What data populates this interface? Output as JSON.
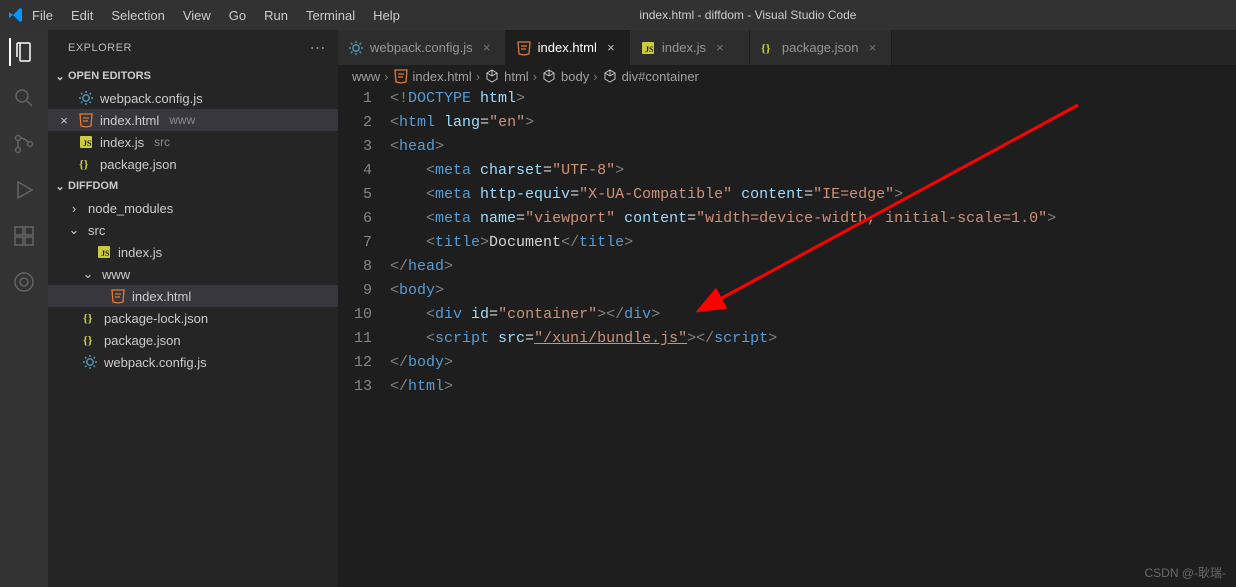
{
  "titlebar": {
    "title": "index.html - diffdom - Visual Studio Code",
    "menu": [
      "File",
      "Edit",
      "Selection",
      "View",
      "Go",
      "Run",
      "Terminal",
      "Help"
    ]
  },
  "sidebar": {
    "title": "EXPLORER",
    "sections": {
      "open_editors": {
        "label": "OPEN EDITORS",
        "items": [
          {
            "name": "webpack.config.js",
            "icon": "gear",
            "close": false
          },
          {
            "name": "index.html",
            "meta": "www",
            "icon": "html",
            "close": true,
            "active": true
          },
          {
            "name": "index.js",
            "meta": "src",
            "icon": "js",
            "close": false
          },
          {
            "name": "package.json",
            "icon": "json",
            "close": false
          }
        ]
      },
      "project": {
        "label": "DIFFDOM",
        "tree": [
          {
            "name": "node_modules",
            "type": "folder",
            "expanded": false,
            "indent": 0
          },
          {
            "name": "src",
            "type": "folder",
            "expanded": true,
            "indent": 0
          },
          {
            "name": "index.js",
            "type": "file",
            "icon": "js",
            "indent": 1
          },
          {
            "name": "www",
            "type": "folder",
            "expanded": true,
            "indent": 1
          },
          {
            "name": "index.html",
            "type": "file",
            "icon": "html",
            "indent": 2,
            "active": true
          },
          {
            "name": "package-lock.json",
            "type": "file",
            "icon": "json",
            "indent": 0
          },
          {
            "name": "package.json",
            "type": "file",
            "icon": "json",
            "indent": 0
          },
          {
            "name": "webpack.config.js",
            "type": "file",
            "icon": "gear",
            "indent": 0
          }
        ]
      }
    }
  },
  "tabs": [
    {
      "name": "webpack.config.js",
      "icon": "gear",
      "active": false
    },
    {
      "name": "index.html",
      "icon": "html",
      "active": true
    },
    {
      "name": "index.js",
      "icon": "js",
      "active": false
    },
    {
      "name": "package.json",
      "icon": "json",
      "active": false
    }
  ],
  "breadcrumb": [
    "www",
    "index.html",
    "html",
    "body",
    "div#container"
  ],
  "code": {
    "lines": [
      [
        {
          "t": "<!",
          "c": "bracket"
        },
        {
          "t": "DOCTYPE",
          "c": "doctype"
        },
        {
          "t": " html",
          "c": "attr"
        },
        {
          "t": ">",
          "c": "bracket"
        }
      ],
      [
        {
          "t": "<",
          "c": "bracket"
        },
        {
          "t": "html",
          "c": "tag"
        },
        {
          "t": " lang",
          "c": "attr"
        },
        {
          "t": "=",
          "c": "text"
        },
        {
          "t": "\"en\"",
          "c": "str"
        },
        {
          "t": ">",
          "c": "bracket"
        }
      ],
      [
        {
          "t": "<",
          "c": "bracket"
        },
        {
          "t": "head",
          "c": "tag"
        },
        {
          "t": ">",
          "c": "bracket"
        }
      ],
      [
        {
          "t": "    <",
          "c": "bracket"
        },
        {
          "t": "meta",
          "c": "tag"
        },
        {
          "t": " charset",
          "c": "attr"
        },
        {
          "t": "=",
          "c": "text"
        },
        {
          "t": "\"UTF-8\"",
          "c": "str"
        },
        {
          "t": ">",
          "c": "bracket"
        }
      ],
      [
        {
          "t": "    <",
          "c": "bracket"
        },
        {
          "t": "meta",
          "c": "tag"
        },
        {
          "t": " http-equiv",
          "c": "attr"
        },
        {
          "t": "=",
          "c": "text"
        },
        {
          "t": "\"X-UA-Compatible\"",
          "c": "str"
        },
        {
          "t": " content",
          "c": "attr"
        },
        {
          "t": "=",
          "c": "text"
        },
        {
          "t": "\"IE=edge\"",
          "c": "str"
        },
        {
          "t": ">",
          "c": "bracket"
        }
      ],
      [
        {
          "t": "    <",
          "c": "bracket"
        },
        {
          "t": "meta",
          "c": "tag"
        },
        {
          "t": " name",
          "c": "attr"
        },
        {
          "t": "=",
          "c": "text"
        },
        {
          "t": "\"viewport\"",
          "c": "str"
        },
        {
          "t": " content",
          "c": "attr"
        },
        {
          "t": "=",
          "c": "text"
        },
        {
          "t": "\"width=device-width, initial-scale=1.0\"",
          "c": "str"
        },
        {
          "t": ">",
          "c": "bracket"
        }
      ],
      [
        {
          "t": "    <",
          "c": "bracket"
        },
        {
          "t": "title",
          "c": "tag"
        },
        {
          "t": ">",
          "c": "bracket"
        },
        {
          "t": "Document",
          "c": "text"
        },
        {
          "t": "</",
          "c": "bracket"
        },
        {
          "t": "title",
          "c": "tag"
        },
        {
          "t": ">",
          "c": "bracket"
        }
      ],
      [
        {
          "t": "</",
          "c": "bracket"
        },
        {
          "t": "head",
          "c": "tag"
        },
        {
          "t": ">",
          "c": "bracket"
        }
      ],
      [
        {
          "t": "<",
          "c": "bracket"
        },
        {
          "t": "body",
          "c": "tag"
        },
        {
          "t": ">",
          "c": "bracket"
        }
      ],
      [
        {
          "t": "    <",
          "c": "bracket"
        },
        {
          "t": "div",
          "c": "tag"
        },
        {
          "t": " id",
          "c": "attr"
        },
        {
          "t": "=",
          "c": "text"
        },
        {
          "t": "\"container\"",
          "c": "str"
        },
        {
          "t": "></",
          "c": "bracket"
        },
        {
          "t": "div",
          "c": "tag"
        },
        {
          "t": ">",
          "c": "bracket"
        }
      ],
      [
        {
          "t": "    <",
          "c": "bracket"
        },
        {
          "t": "script",
          "c": "tag"
        },
        {
          "t": " src",
          "c": "attr"
        },
        {
          "t": "=",
          "c": "text"
        },
        {
          "t": "\"/xuni/bundle.js\"",
          "c": "str underline"
        },
        {
          "t": "></",
          "c": "bracket"
        },
        {
          "t": "script",
          "c": "tag"
        },
        {
          "t": ">",
          "c": "bracket"
        }
      ],
      [
        {
          "t": "</",
          "c": "bracket"
        },
        {
          "t": "body",
          "c": "tag"
        },
        {
          "t": ">",
          "c": "bracket"
        }
      ],
      [
        {
          "t": "</",
          "c": "bracket"
        },
        {
          "t": "html",
          "c": "tag"
        },
        {
          "t": ">",
          "c": "bracket"
        }
      ]
    ]
  },
  "watermark": "CSDN @-耿瑞-"
}
